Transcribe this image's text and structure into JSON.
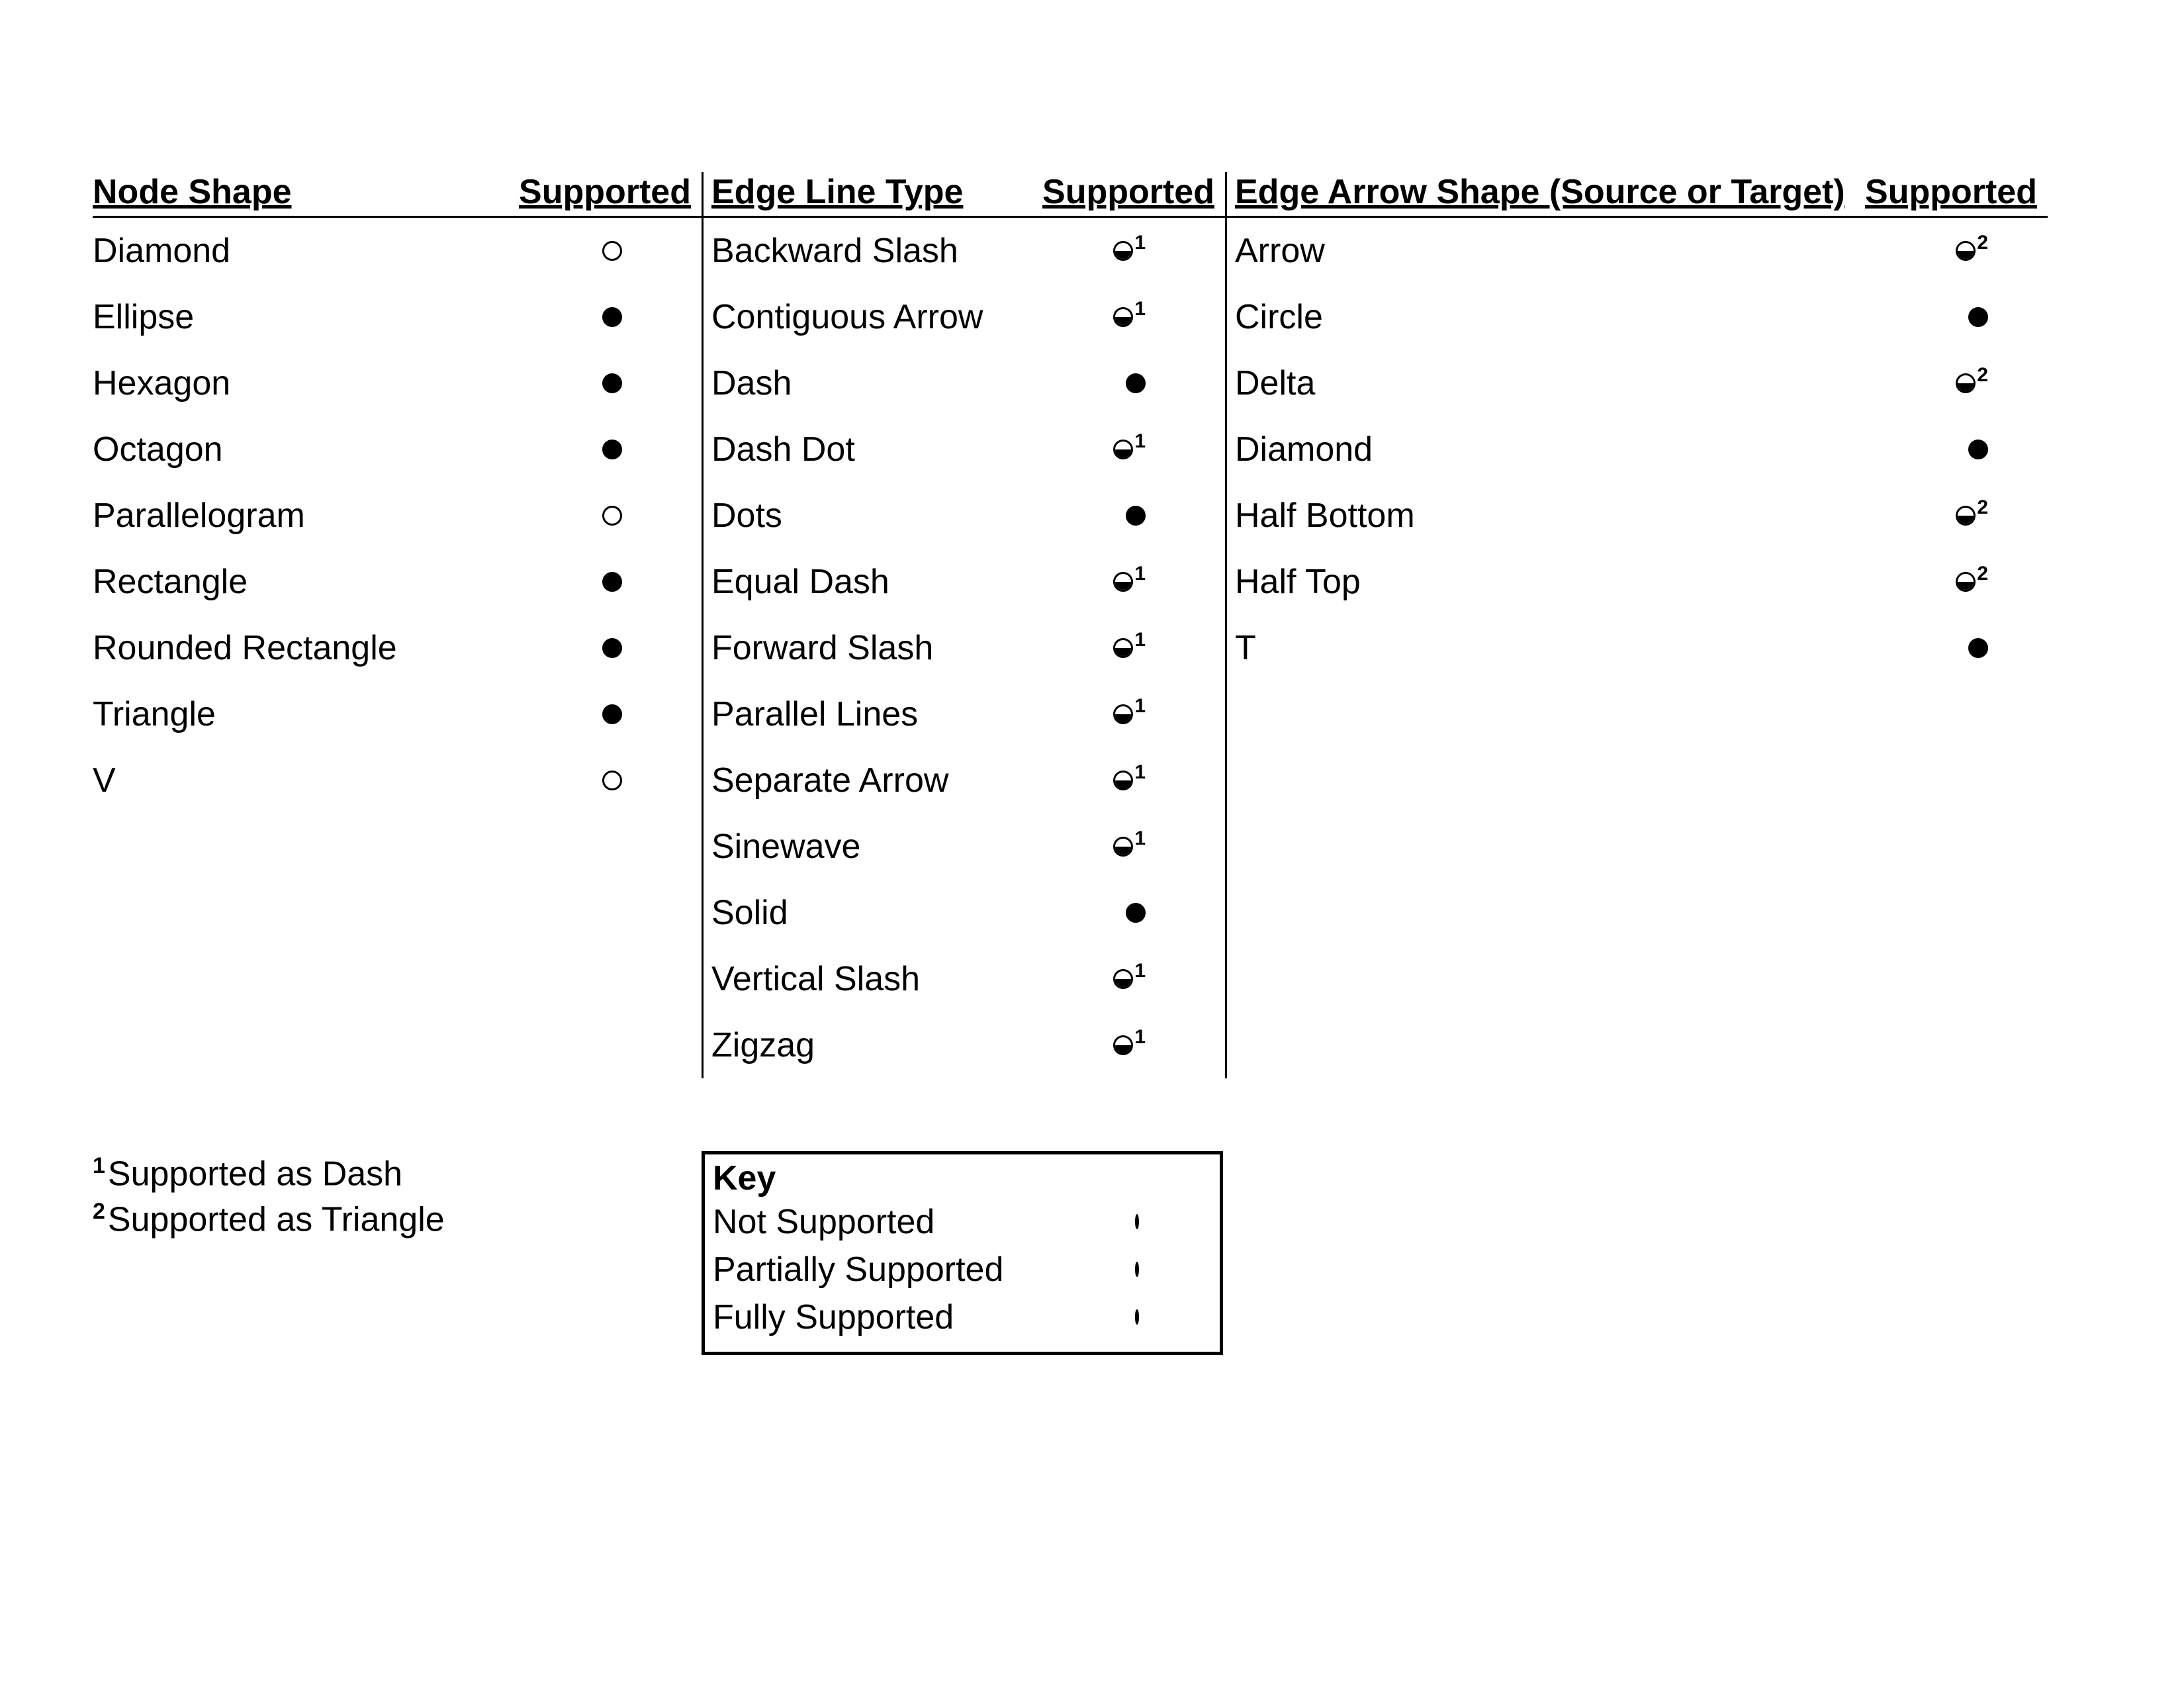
{
  "headers": {
    "node_shape": "Node Shape",
    "edge_line": "Edge Line Type",
    "edge_arrow": "Edge Arrow Shape (Source or Target)",
    "supported": "Supported"
  },
  "node_shapes": [
    {
      "label": "Diamond",
      "support": "none"
    },
    {
      "label": "Ellipse",
      "support": "full"
    },
    {
      "label": "Hexagon",
      "support": "full"
    },
    {
      "label": "Octagon",
      "support": "full"
    },
    {
      "label": "Parallelogram",
      "support": "none"
    },
    {
      "label": "Rectangle",
      "support": "full"
    },
    {
      "label": "Rounded Rectangle",
      "support": "full"
    },
    {
      "label": "Triangle",
      "support": "full"
    },
    {
      "label": "V",
      "support": "none"
    }
  ],
  "edge_lines": [
    {
      "label": "Backward Slash",
      "support": "half",
      "note": "1"
    },
    {
      "label": "Contiguous Arrow",
      "support": "half",
      "note": "1"
    },
    {
      "label": "Dash",
      "support": "full"
    },
    {
      "label": "Dash Dot",
      "support": "half",
      "note": "1"
    },
    {
      "label": "Dots",
      "support": "full"
    },
    {
      "label": "Equal Dash",
      "support": "half",
      "note": "1"
    },
    {
      "label": "Forward Slash",
      "support": "half",
      "note": "1"
    },
    {
      "label": "Parallel Lines",
      "support": "half",
      "note": "1"
    },
    {
      "label": "Separate Arrow",
      "support": "half",
      "note": "1"
    },
    {
      "label": "Sinewave",
      "support": "half",
      "note": "1"
    },
    {
      "label": "Solid",
      "support": "full"
    },
    {
      "label": "Vertical Slash",
      "support": "half",
      "note": "1"
    },
    {
      "label": "Zigzag",
      "support": "half",
      "note": "1"
    }
  ],
  "edge_arrows": [
    {
      "label": "Arrow",
      "support": "half",
      "note": "2"
    },
    {
      "label": "Circle",
      "support": "full"
    },
    {
      "label": "Delta",
      "support": "half",
      "note": "2"
    },
    {
      "label": "Diamond",
      "support": "full"
    },
    {
      "label": "Half Bottom",
      "support": "half",
      "note": "2"
    },
    {
      "label": "Half Top",
      "support": "half",
      "note": "2"
    },
    {
      "label": "T",
      "support": "full"
    }
  ],
  "footnotes": {
    "1": "Supported as Dash",
    "2": "Supported as Triangle"
  },
  "key": {
    "title": "Key",
    "items": [
      {
        "label": "Not Supported",
        "support": "none"
      },
      {
        "label": "Partially Supported",
        "support": "half"
      },
      {
        "label": "Fully Supported",
        "support": "full"
      }
    ]
  }
}
